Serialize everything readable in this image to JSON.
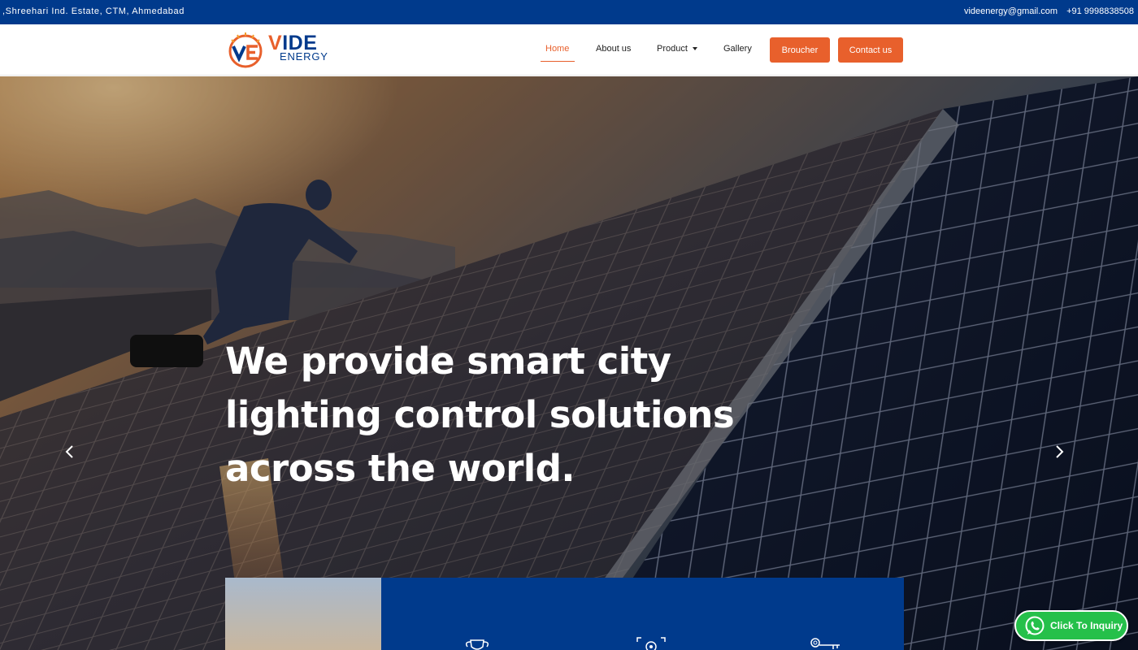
{
  "topbar": {
    "address": ",Shreehari Ind. Estate, CTM, Ahmedabad",
    "email": "videenergy@gmail.com",
    "phone": "+91 9998838508"
  },
  "brand": {
    "name_first": "V",
    "name_rest": "IDE",
    "tagline": "ENERGY",
    "primary_color": "#003a8c",
    "accent_color": "#e8602c"
  },
  "nav": {
    "items": [
      {
        "label": "Home",
        "active": true
      },
      {
        "label": "About us",
        "active": false
      },
      {
        "label": "Product",
        "active": false,
        "dropdown": true
      },
      {
        "label": "Gallery",
        "active": false
      }
    ],
    "buttons": [
      {
        "label": "Broucher"
      },
      {
        "label": "Contact us"
      }
    ]
  },
  "hero": {
    "headline": "We provide smart city\nlighting control solutions\nacross the world.",
    "prev_icon": "chevron-left-icon",
    "next_icon": "chevron-right-icon"
  },
  "features": {
    "icons": [
      "trophy-icon",
      "target-icon",
      "key-icon"
    ]
  },
  "whatsapp": {
    "label": "Click To Inquiry",
    "icon": "whatsapp-icon",
    "color": "#25c04a"
  }
}
